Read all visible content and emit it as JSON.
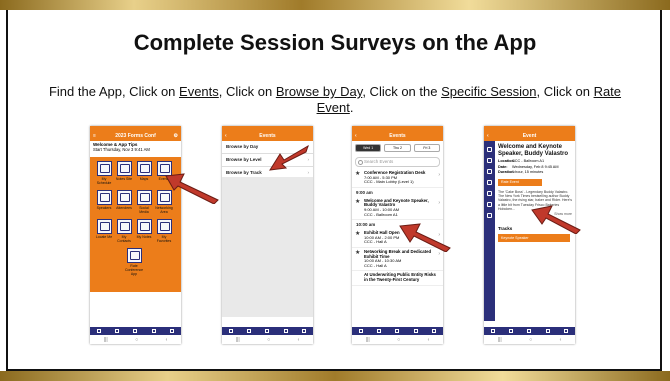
{
  "title": "Complete Session Surveys on the App",
  "instructions": {
    "t1": "Find the App, Click on ",
    "l1": "Events",
    "t2": ", Click on ",
    "l2": "Browse by Day",
    "t3": ", Click on the ",
    "l3": "Specific Session",
    "t4": ", Click on ",
    "l4": "Rate Event",
    "t5": "."
  },
  "colors": {
    "accent": "#ec7d1a",
    "navy": "#2b2f7a",
    "arrow": "#c0392b"
  },
  "phone1": {
    "header": "2023 Forms Conf",
    "welcome_title": "Welcome & App Tips",
    "welcome_time": "Start Thursday, Nov 3 9:41 AM",
    "tiles": [
      "My Schedule",
      "Notes Site",
      "Maps",
      "Events",
      "Speakers",
      "Attendees",
      "Social Media",
      "Networking Area",
      "Locate Me",
      "My Contacts",
      "My Notes",
      "My Favorites",
      "Rate Conference App"
    ]
  },
  "phone2": {
    "header": "Events",
    "rows": [
      "Browse by Day",
      "Browse by Level",
      "Browse by Track"
    ]
  },
  "phone3": {
    "header": "Events",
    "tabs": [
      "Wed 1",
      "Thu 2",
      "Fri 3"
    ],
    "search_placeholder": "Search Events",
    "items": [
      {
        "title": "Conference Registration Desk",
        "time": "7:00 AM - 5:30 PM",
        "place": "CCC - Main Lobby (Level 1)"
      },
      {
        "header": "9:00 am"
      },
      {
        "title": "Welcome and Keynote Speaker, Buddy Valastro",
        "time": "9:00 AM - 10:00 AM",
        "place": "CCC - Ballroom A1"
      },
      {
        "header": "10:00 am"
      },
      {
        "title": "Exhibit Hall Open",
        "time": "10:00 AM - 2:00 PM",
        "place": "CCC - Hall A"
      },
      {
        "title": "Networking Break and Dedicated Exhibit Time",
        "time": "10:00 AM - 10:30 AM",
        "place": "CCC - Hall A"
      },
      {
        "title": "AI Underwriting Public Entity Risks in the Twenty-First Century",
        "time": "",
        "place": ""
      }
    ]
  },
  "phone4": {
    "header": "Event",
    "title": "Welcome and Keynote Speaker, Buddy Valastro",
    "location_label": "Location:",
    "location": "CCC - Ballroom A1",
    "date_label": "Date:",
    "date": "Wednesday, Feb 8 9:45 AM",
    "duration_label": "Duration:",
    "duration": "1 hour, 15 minutes",
    "rate_button": "Rate Event",
    "desc": "The 'Cake Boss' - Legendary Buddy Valastro. The New York Times bestselling author Buddy Valastro, the rising star, baker and Rider. Here's a little bit from Tuesday Frisco Bakeries Hoboken...",
    "show_more": "Show more",
    "tracks_label": "Tracks",
    "track_button": "Keynote Speaker"
  }
}
